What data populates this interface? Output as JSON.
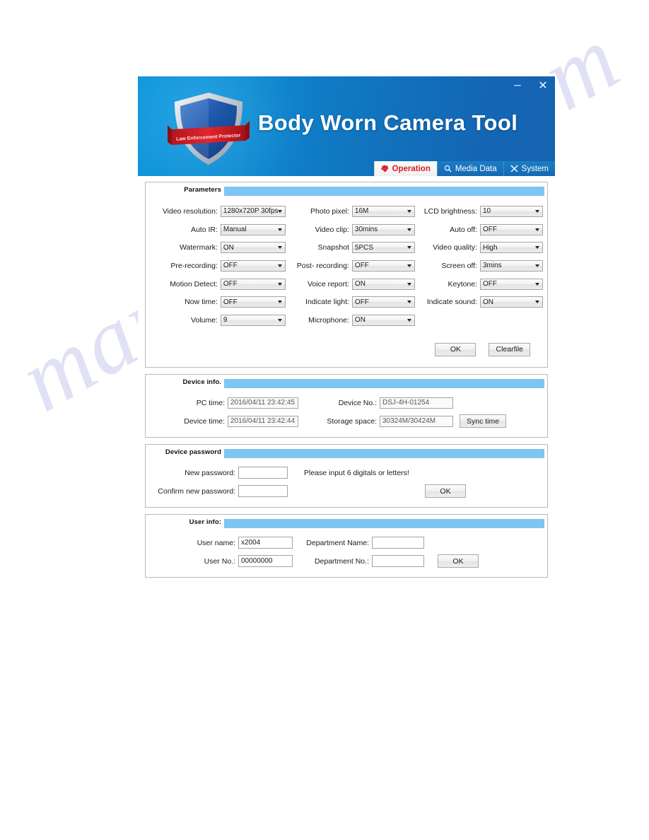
{
  "watermark": {
    "text": "manualshive.com"
  },
  "window": {
    "title": "Body Worn Camera Tool",
    "logo_banner": "Law Enforcement Protector",
    "minimize_label": "–",
    "close_label": "✕",
    "colors": {
      "header_left": "#0b93d9",
      "header_right": "#1563b1",
      "panel_bar": "#7ec5f2",
      "active_tab_text": "#d8202a"
    }
  },
  "tabs": [
    {
      "label": "Operation",
      "icon": "shield-icon",
      "active": true
    },
    {
      "label": "Media Data",
      "icon": "search-icon",
      "active": false
    },
    {
      "label": "System",
      "icon": "wrench-icon",
      "active": false
    }
  ],
  "parameters": {
    "title": "Parameters",
    "rows": [
      [
        {
          "label": "Video resolution:",
          "value": "1280x720P 30fps"
        },
        {
          "label": "Photo pixel:",
          "value": "16M"
        },
        {
          "label": "LCD brightness:",
          "value": "10"
        }
      ],
      [
        {
          "label": "Auto IR:",
          "value": "Manual"
        },
        {
          "label": "Video clip:",
          "value": "30mins"
        },
        {
          "label": "Auto off:",
          "value": "OFF"
        }
      ],
      [
        {
          "label": "Watermark:",
          "value": "ON"
        },
        {
          "label": "Snapshot",
          "value": "5PCS"
        },
        {
          "label": "Video quality:",
          "value": "High"
        }
      ],
      [
        {
          "label": "Pre-recording:",
          "value": "OFF"
        },
        {
          "label": "Post- recording:",
          "value": "OFF"
        },
        {
          "label": "Screen off:",
          "value": "3mins"
        }
      ],
      [
        {
          "label": "Motion Detect:",
          "value": "OFF"
        },
        {
          "label": "Voice report:",
          "value": "ON"
        },
        {
          "label": "Keytone:",
          "value": "OFF"
        }
      ],
      [
        {
          "label": "Now time:",
          "value": "OFF"
        },
        {
          "label": "Indicate light:",
          "value": "OFF"
        },
        {
          "label": "Indicate sound:",
          "value": "ON"
        }
      ],
      [
        {
          "label": "Volume:",
          "value": "9"
        },
        {
          "label": "Microphone:",
          "value": "ON"
        },
        {
          "label": "",
          "value": ""
        }
      ]
    ],
    "ok_label": "OK",
    "clearfile_label": "Clearfile"
  },
  "device_info": {
    "title": "Device info.",
    "pc_time_label": "PC time:",
    "pc_time_value": "2016/04/11 23:42:45",
    "device_no_label": "Device No.:",
    "device_no_value": "DSJ-4H-01254",
    "device_time_label": "Device time:",
    "device_time_value": "2016/04/11 23:42:44",
    "storage_label": "Storage space:",
    "storage_value": "30324M/30424M",
    "sync_label": "Sync time"
  },
  "device_password": {
    "title": "Device password",
    "new_label": "New password:",
    "new_value": "",
    "confirm_label": "Confirm new password:",
    "confirm_value": "",
    "hint": "Please input 6 digitals or letters!",
    "ok_label": "OK"
  },
  "user_info": {
    "title": "User info:",
    "user_name_label": "User name:",
    "user_name_value": "x2004",
    "dept_name_label": "Department Name:",
    "dept_name_value": "",
    "user_no_label": "User No.:",
    "user_no_value": "00000000",
    "dept_no_label": "Department No.:",
    "dept_no_value": "",
    "ok_label": "OK"
  }
}
